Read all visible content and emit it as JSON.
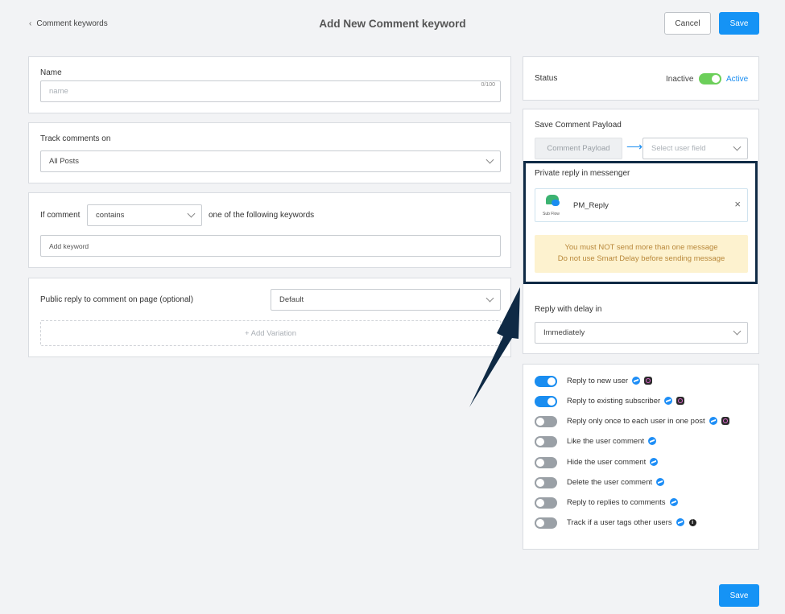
{
  "header": {
    "back_label": "Comment keywords",
    "title": "Add New Comment keyword",
    "cancel_label": "Cancel",
    "save_label": "Save"
  },
  "name_card": {
    "label": "Name",
    "placeholder": "name",
    "counter": "0/100"
  },
  "track_card": {
    "label": "Track comments on",
    "value": "All Posts"
  },
  "if_comment_card": {
    "label": "If comment",
    "condition": "contains",
    "suffix": "one of the following keywords",
    "keyword_placeholder": "Add keyword"
  },
  "public_reply_card": {
    "label": "Public reply to comment on page (optional)",
    "value": "Default",
    "add_variation": "+ Add Variation"
  },
  "status_card": {
    "label": "Status",
    "inactive": "Inactive",
    "active": "Active"
  },
  "payload_card": {
    "label": "Save Comment Payload",
    "payload_button": "Comment Payload",
    "arrow": "⟶",
    "select_placeholder": "Select user field"
  },
  "private_reply": {
    "label": "Private reply in messenger",
    "flow_name": "PM_Reply",
    "flow_caption": "Sub Flow",
    "warning_line1": "You must NOT send more than one message",
    "warning_line2": "Do not use Smart Delay before sending message"
  },
  "delay_card": {
    "label": "Reply with delay in",
    "value": "Immediately"
  },
  "options": [
    {
      "label": "Reply to new user",
      "on": true
    },
    {
      "label": "Reply to existing subscriber",
      "on": true
    },
    {
      "label": "Reply only once to each user in one post",
      "on": false
    },
    {
      "label": "Like the user comment",
      "on": false
    },
    {
      "label": "Hide the user comment",
      "on": false
    },
    {
      "label": "Delete the user comment",
      "on": false
    },
    {
      "label": "Reply to replies to comments",
      "on": false
    },
    {
      "label": "Track if a user tags other users",
      "on": false
    }
  ],
  "colors": {
    "accent": "#1593f5",
    "toggle_on": "#1a8df0",
    "status_on": "#6ccf5a",
    "warning_bg": "#fdf2cf",
    "highlight_border": "#0f2a45"
  }
}
